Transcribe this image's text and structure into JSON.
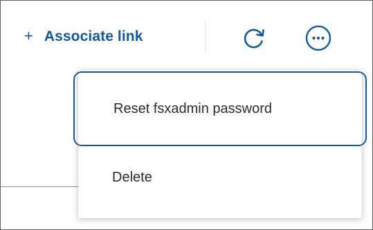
{
  "toolbar": {
    "associate_icon": "plus-icon",
    "associate_label": "Associate link",
    "refresh_icon": "refresh-icon",
    "more_icon": "more-options-icon"
  },
  "menu": {
    "items": [
      {
        "label": "Reset fsxadmin password",
        "state": "focused"
      },
      {
        "label": "Delete",
        "state": "normal"
      }
    ]
  },
  "colors": {
    "accent": "#0e5aa7",
    "menu_text": "#2b2b2b",
    "frame_border": "#5f5f5f",
    "divider": "#e3e3e3"
  }
}
